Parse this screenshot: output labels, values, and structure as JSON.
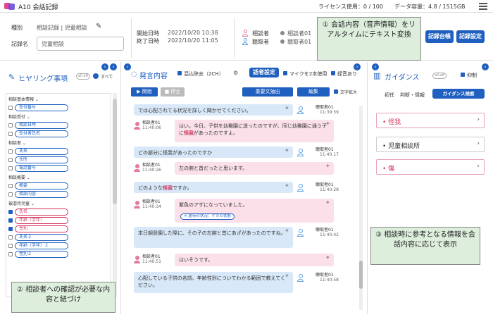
{
  "app": {
    "title": "A10 会話記録",
    "license": "ライセンス使用：0 / 100",
    "capacity": "データ容量：4.8 / 1515GB"
  },
  "header": {
    "type_label": "種別",
    "type_value": "相談記録 | 児童相談",
    "record_label": "記録名",
    "record_value": "児童相談",
    "start_label": "開始日時",
    "start_value": "2022/10/20 10:38",
    "end_label": "終了日時",
    "end_value": "2022/10/20 11:05",
    "consultant_label": "相談者",
    "consultant_value": "相談者01",
    "listener_label": "聴取者",
    "listener_value": "聴取者01",
    "btn_record_ledger": "記録台帳",
    "btn_record_settings": "記録設定"
  },
  "left": {
    "title": "ヒヤリング事項",
    "toggle": "all off",
    "all": "すべて",
    "groups": [
      {
        "title": "相談基本情報",
        "items": [
          {
            "label": "受付番号",
            "checked": false,
            "red": false
          }
        ]
      },
      {
        "title": "相談受付",
        "items": [
          {
            "label": "相談日時",
            "checked": false,
            "red": false
          },
          {
            "label": "受付者氏名",
            "checked": false,
            "red": false
          }
        ]
      },
      {
        "title": "相談者",
        "items": [
          {
            "label": "氏名",
            "checked": false,
            "red": false
          },
          {
            "label": "住所",
            "checked": false,
            "red": false
          },
          {
            "label": "電話番号",
            "checked": false,
            "red": false
          }
        ]
      },
      {
        "title": "相談概要",
        "items": [
          {
            "label": "概要",
            "checked": false,
            "red": false
          },
          {
            "label": "相談内容",
            "checked": false,
            "red": false
          }
        ]
      },
      {
        "title": "被虐待児童",
        "items": [
          {
            "label": "氏名",
            "checked": true,
            "red": true
          },
          {
            "label": "年齢（学年）",
            "checked": true,
            "red": true
          },
          {
            "label": "性別",
            "checked": true,
            "red": true
          },
          {
            "label": "氏名２",
            "checked": false,
            "red": false
          },
          {
            "label": "年齢（学年）２",
            "checked": false,
            "red": false
          },
          {
            "label": "性別２",
            "checked": false,
            "red": false
          }
        ]
      }
    ]
  },
  "center": {
    "title": "発言内容",
    "noise": "混込除去（2CH）",
    "speaker_settings": "話者設定",
    "mic_input": "マイクを2本使用",
    "recording": "録音あり",
    "btn_start": "▶ 開始",
    "btn_stop": "■ 停止",
    "btn_extract": "重要文抽出",
    "btn_edit": "編集",
    "font_up": "文字拡大",
    "messages": [
      {
        "speaker": "聴取者01",
        "time": "11:39:59",
        "text": "では心配されてる状況を詳しく聞かせてください。"
      },
      {
        "speaker": "相談者01",
        "time": "11:40:06",
        "text_pre": "はい。今日、子供を幼稚園に送ったのですが、同じ幼稚園に通う子に",
        "hl": "怪我",
        "text_post": "があったのですよ。"
      },
      {
        "speaker": "聴取者01",
        "time": "11:40:17",
        "text": "どの部分に怪我があったのですか"
      },
      {
        "speaker": "相談者01",
        "time": "11:40:26",
        "text": "左の腕と首だったと思います。"
      },
      {
        "speaker": "聴取者01",
        "time": "11:40:28",
        "text_pre": "どのような",
        "hl": "怪我",
        "text_post": "ですか。"
      },
      {
        "speaker": "相談者01",
        "time": "11:40:34",
        "text": "紫色のアザになっていました。",
        "tag": "✕ 虐待の状況：ケガの状態"
      },
      {
        "speaker": "聴取者01",
        "time": "11:40:42",
        "text": "本日朝登園した際に、その子の左腕と首にあざがあったのですね。"
      },
      {
        "speaker": "相談者01",
        "time": "11:40:51",
        "text": "はいそうです。"
      },
      {
        "speaker": "聴取者01",
        "time": "11:40:58",
        "text": "心配している子供の名前、年齢性別についてわかる範囲で教えてください。"
      }
    ]
  },
  "right": {
    "title": "ガイダンス",
    "toggle": "all off",
    "suppress": "抑制",
    "tab_initial": "初任",
    "tab_judgement": "判断・情報",
    "search": "ガイダンス検索",
    "cards": [
      "怪我",
      "児童相談所",
      "傷"
    ]
  },
  "callouts": {
    "c1": "① 会話内容（音声情報）をリアルタイムにテキスト変換",
    "c2": "② 相談者への確認が必要な内容と紐づけ",
    "c3": "③ 相談時に参考となる情報を会話内容に応じて表示"
  }
}
